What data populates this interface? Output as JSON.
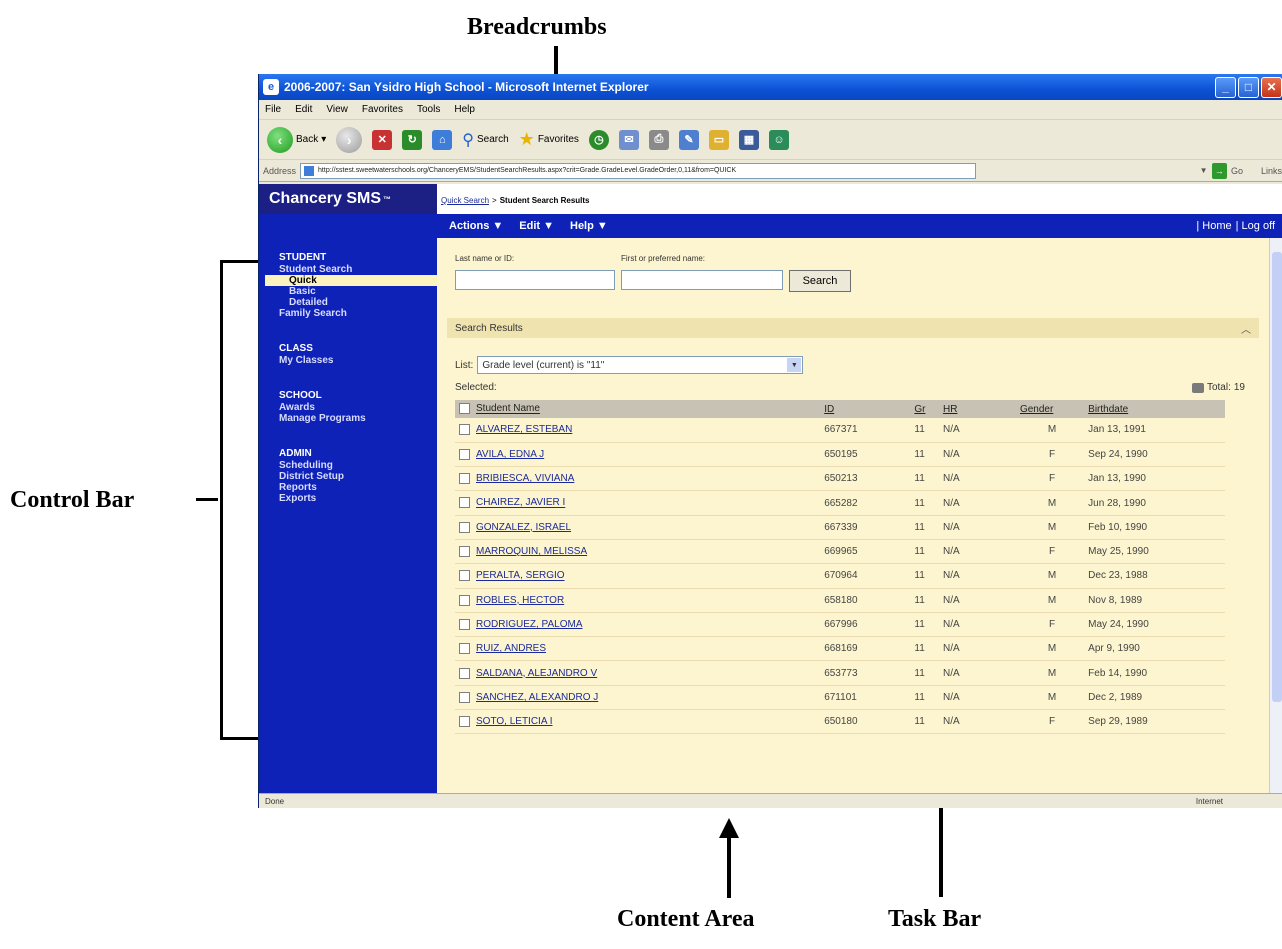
{
  "annotations": {
    "breadcrumbs": "Breadcrumbs",
    "control_bar": "Control Bar",
    "content_area": "Content Area",
    "task_bar": "Task Bar"
  },
  "browser": {
    "title": "2006-2007: San Ysidro High School - Microsoft Internet Explorer",
    "menu": [
      "File",
      "Edit",
      "View",
      "Favorites",
      "Tools",
      "Help"
    ],
    "toolbar": {
      "back": "Back",
      "search": "Search",
      "favorites": "Favorites"
    },
    "address_label": "Address",
    "address_url": "http://sstest.sweetwaterschools.org/ChanceryEMS/StudentSearchResults.aspx?crit=Grade.GradeLevel.GradeOrder,0,11&from=QUICK",
    "go_label": "Go",
    "links_label": "Links",
    "status_left": "Done",
    "status_right": "Internet"
  },
  "app": {
    "brand": "Chancery SMS",
    "brand_mark": "™",
    "breadcrumb": {
      "link": "Quick Search",
      "separator": ">",
      "current": "Student Search Results"
    }
  },
  "sidebar": {
    "groups": [
      {
        "head": "STUDENT",
        "items": [
          {
            "label": "Student Search",
            "level": 1
          },
          {
            "label": "Quick",
            "level": 2,
            "active": true
          },
          {
            "label": "Basic",
            "level": 2
          },
          {
            "label": "Detailed",
            "level": 2
          },
          {
            "label": "Family Search",
            "level": 1
          }
        ]
      },
      {
        "head": "CLASS",
        "items": [
          {
            "label": "My Classes",
            "level": 1
          }
        ]
      },
      {
        "head": "SCHOOL",
        "items": [
          {
            "label": "Awards",
            "level": 1
          },
          {
            "label": "Manage Programs",
            "level": 1
          }
        ]
      },
      {
        "head": "ADMIN",
        "items": [
          {
            "label": "Scheduling",
            "level": 1
          },
          {
            "label": "District Setup",
            "level": 1
          },
          {
            "label": "Reports",
            "level": 1
          },
          {
            "label": "Exports",
            "level": 1
          }
        ]
      }
    ]
  },
  "taskbar": {
    "actions": "Actions ▼",
    "edit": "Edit ▼",
    "help": "Help ▼",
    "home": "| Home",
    "logoff": "| Log off"
  },
  "search": {
    "last_name_label": "Last name or ID:",
    "first_name_label": "First or preferred name:",
    "button": "Search"
  },
  "results": {
    "section_title": "Search Results",
    "list_label": "List:",
    "list_value": "Grade level (current) is \"11\"",
    "selected_label": "Selected:",
    "total_label": "Total:",
    "total_value": "19",
    "columns": [
      "Student Name",
      "ID",
      "Gr",
      "HR",
      "Gender",
      "Birthdate"
    ],
    "rows": [
      [
        "ALVAREZ, ESTEBAN",
        "667371",
        "11",
        "N/A",
        "M",
        "Jan 13, 1991"
      ],
      [
        "AVILA, EDNA J",
        "650195",
        "11",
        "N/A",
        "F",
        "Sep 24, 1990"
      ],
      [
        "BRIBIESCA, VIVIANA",
        "650213",
        "11",
        "N/A",
        "F",
        "Jan 13, 1990"
      ],
      [
        "CHAIREZ, JAVIER I",
        "665282",
        "11",
        "N/A",
        "M",
        "Jun 28, 1990"
      ],
      [
        "GONZALEZ, ISRAEL",
        "667339",
        "11",
        "N/A",
        "M",
        "Feb 10, 1990"
      ],
      [
        "MARROQUIN, MELISSA",
        "669965",
        "11",
        "N/A",
        "F",
        "May 25, 1990"
      ],
      [
        "PERALTA, SERGIO",
        "670964",
        "11",
        "N/A",
        "M",
        "Dec 23, 1988"
      ],
      [
        "ROBLES, HECTOR",
        "658180",
        "11",
        "N/A",
        "M",
        "Nov 8, 1989"
      ],
      [
        "RODRIGUEZ, PALOMA",
        "667996",
        "11",
        "N/A",
        "F",
        "May 24, 1990"
      ],
      [
        "RUIZ, ANDRES",
        "668169",
        "11",
        "N/A",
        "M",
        "Apr 9, 1990"
      ],
      [
        "SALDANA, ALEJANDRO V",
        "653773",
        "11",
        "N/A",
        "M",
        "Feb 14, 1990"
      ],
      [
        "SANCHEZ, ALEXANDRO J",
        "671101",
        "11",
        "N/A",
        "M",
        "Dec 2, 1989"
      ],
      [
        "SOTO, LETICIA I",
        "650180",
        "11",
        "N/A",
        "F",
        "Sep 29, 1989"
      ]
    ]
  }
}
